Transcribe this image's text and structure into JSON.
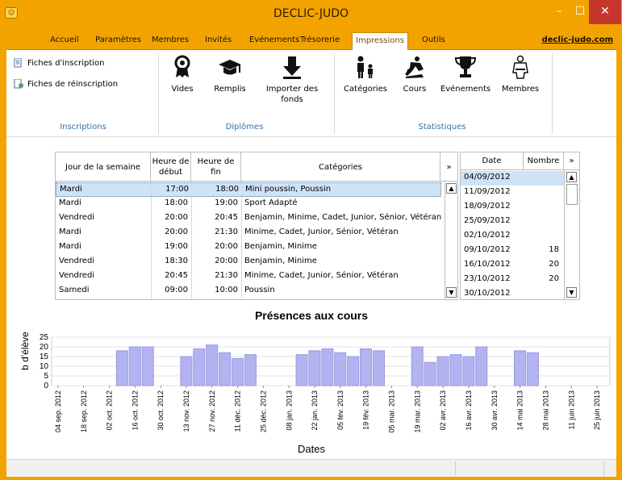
{
  "window": {
    "title": "DECLIC-JUDO",
    "minimize": "–",
    "maximize": "☐",
    "close": "✕"
  },
  "menu": {
    "tabs": [
      "Accueil",
      "Paramètres",
      "Membres",
      "Invités",
      "Evénements",
      "Trésorerie",
      "Impressions",
      "Outils"
    ],
    "active": "Impressions",
    "site_link": "declic-judo.com"
  },
  "ribbon": {
    "inscriptions": {
      "label": "Inscriptions",
      "items": [
        "Fiches d'inscription",
        "Fiches de réinscription"
      ]
    },
    "diplomes": {
      "label": "Diplômes",
      "items": [
        "Vides",
        "Remplis",
        "Importer des fonds"
      ]
    },
    "statistiques": {
      "label": "Statistiques",
      "items": [
        "Catégories",
        "Cours",
        "Evénements",
        "Membres"
      ]
    }
  },
  "schedule": {
    "headers": [
      "Jour de la semaine",
      "Heure de début",
      "Heure de fin",
      "Catégories",
      "»"
    ],
    "rows": [
      [
        "Mardi",
        "17:00",
        "18:00",
        "Mini poussin, Poussin"
      ],
      [
        "Mardi",
        "18:00",
        "19:00",
        "Sport Adapté"
      ],
      [
        "Vendredi",
        "20:00",
        "20:45",
        "Benjamin, Minime, Cadet, Junior, Sénior, Vétéran"
      ],
      [
        "Mardi",
        "20:00",
        "21:30",
        "Minime, Cadet, Junior, Sénior, Vétéran"
      ],
      [
        "Mardi",
        "19:00",
        "20:00",
        "Benjamin, Minime"
      ],
      [
        "Vendredi",
        "18:30",
        "20:00",
        "Benjamin, Minime"
      ],
      [
        "Vendredi",
        "20:45",
        "21:30",
        "Minime, Cadet, Junior, Sénior, Vétéran"
      ],
      [
        "Samedi",
        "09:00",
        "10:00",
        "Poussin"
      ]
    ],
    "selected_row": 0
  },
  "dates": {
    "headers": [
      "Date",
      "Nombre",
      "»"
    ],
    "rows": [
      [
        "04/09/2012",
        ""
      ],
      [
        "11/09/2012",
        ""
      ],
      [
        "18/09/2012",
        ""
      ],
      [
        "25/09/2012",
        ""
      ],
      [
        "02/10/2012",
        ""
      ],
      [
        "09/10/2012",
        "18"
      ],
      [
        "16/10/2012",
        "20"
      ],
      [
        "23/10/2012",
        "20"
      ],
      [
        "30/10/2012",
        ""
      ]
    ],
    "selected_row": 0
  },
  "colors": {
    "frame": "#f3a300",
    "bar": "#b3b3f2",
    "selection": "#cfe3f7",
    "ribbon_label": "#3a6ea5"
  },
  "chart_data": {
    "type": "bar",
    "title": "Présences aux cours",
    "xlabel": "Dates",
    "ylabel": "b d'élève",
    "ylim": [
      0,
      25
    ],
    "yticks": [
      0,
      5,
      10,
      15,
      20,
      25
    ],
    "x_tick_labels": [
      "04 sep. 2012",
      "18 sep. 2012",
      "02 oct. 2012",
      "16 oct. 2012",
      "30 oct. 2012",
      "13 nov. 2012",
      "27 nov. 2012",
      "11 déc. 2012",
      "25 déc. 2012",
      "08 jan. 2013",
      "22 jan. 2013",
      "05 fév. 2013",
      "19 fév. 2013",
      "05 mar. 2013",
      "19 mar. 2013",
      "02 avr. 2013",
      "16 avr. 2013",
      "30 avr. 2013",
      "14 mai 2013",
      "28 mai 2013",
      "11 juin 2013",
      "25 juin 2013"
    ],
    "x": [
      "04/09/2012",
      "11/09/2012",
      "18/09/2012",
      "25/09/2012",
      "02/10/2012",
      "09/10/2012",
      "16/10/2012",
      "23/10/2012",
      "30/10/2012",
      "06/11/2012",
      "13/11/2012",
      "20/11/2012",
      "27/11/2012",
      "04/12/2012",
      "11/12/2012",
      "18/12/2012",
      "25/12/2012",
      "01/01/2013",
      "08/01/2013",
      "15/01/2013",
      "22/01/2013",
      "29/01/2013",
      "05/02/2013",
      "12/02/2013",
      "19/02/2013",
      "26/02/2013",
      "05/03/2013",
      "12/03/2013",
      "19/03/2013",
      "26/03/2013",
      "02/04/2013",
      "09/04/2013",
      "16/04/2013",
      "23/04/2013",
      "30/04/2013",
      "07/05/2013",
      "14/05/2013",
      "21/05/2013",
      "28/05/2013",
      "04/06/2013",
      "11/06/2013",
      "18/06/2013",
      "25/06/2013"
    ],
    "values": [
      0,
      0,
      0,
      0,
      0,
      18,
      20,
      20,
      0,
      0,
      15,
      19,
      21,
      17,
      14,
      16,
      0,
      0,
      0,
      16,
      18,
      19,
      17,
      15,
      19,
      18,
      0,
      0,
      20,
      12,
      15,
      16,
      15,
      20,
      0,
      0,
      18,
      17,
      0,
      0,
      0,
      0,
      0
    ],
    "grid": true
  }
}
